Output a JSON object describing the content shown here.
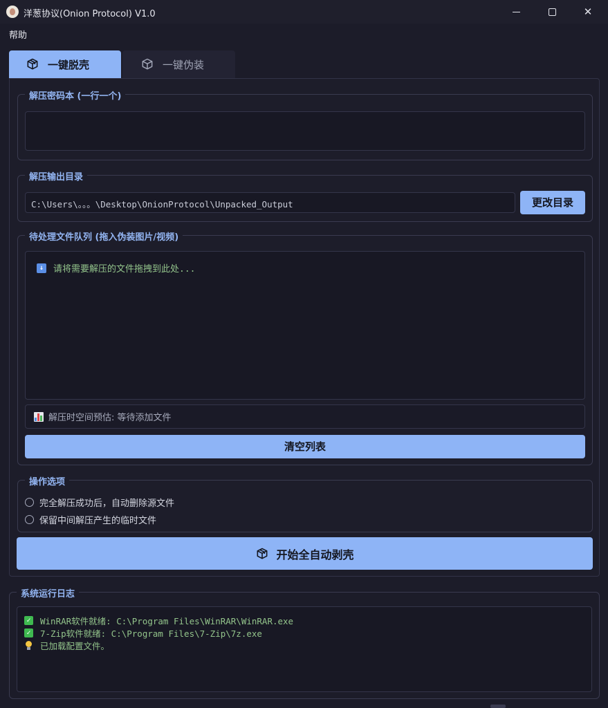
{
  "window": {
    "title": "洋葱协议(Onion Protocol) V1.0",
    "app_icon": "onion-logo-icon",
    "controls": {
      "minimize": "minimize-icon",
      "maximize": "maximize-icon",
      "close": "✕"
    }
  },
  "menu": {
    "help": "帮助"
  },
  "tabs": [
    {
      "label": "一键脱壳",
      "icon": "box-icon",
      "active": true
    },
    {
      "label": "一键伪装",
      "icon": "cube-icon",
      "active": false
    }
  ],
  "password_book": {
    "title": "解压密码本 (一行一个)",
    "value": ""
  },
  "output_dir": {
    "title": "解压输出目录",
    "path": "C:\\Users\\。。。\\Desktop\\OnionProtocol\\Unpacked_Output",
    "change_button": "更改目录"
  },
  "queue": {
    "title": "待处理文件队列 (拖入伪装图片/视频)",
    "drop_hint": "请将需要解压的文件拖拽到此处...",
    "drop_icon": "down-arrow-icon",
    "space_estimate": "解压时空间预估: 等待添加文件",
    "space_icon": "bar-chart-icon",
    "clear_button": "清空列表"
  },
  "options": {
    "title": "操作选项",
    "items": [
      {
        "label": "完全解压成功后，自动删除源文件",
        "checked": false
      },
      {
        "label": "保留中间解压产生的临时文件",
        "checked": false
      }
    ]
  },
  "start_button": {
    "label": "开始全自动剥壳",
    "icon": "box-icon"
  },
  "log": {
    "title": "系统运行日志",
    "lines": [
      {
        "icon": "check-icon",
        "text": "WinRAR软件就绪: C:\\Program Files\\WinRAR\\WinRAR.exe"
      },
      {
        "icon": "check-icon",
        "text": "7-Zip软件就绪: C:\\Program Files\\7-Zip\\7z.exe"
      },
      {
        "icon": "bulb-icon",
        "text": "已加载配置文件。"
      }
    ]
  },
  "colors": {
    "accent": "#8eb4f6",
    "title_text": "#93b5f2",
    "log_text": "#93c48b",
    "background": "#1c1c29"
  }
}
